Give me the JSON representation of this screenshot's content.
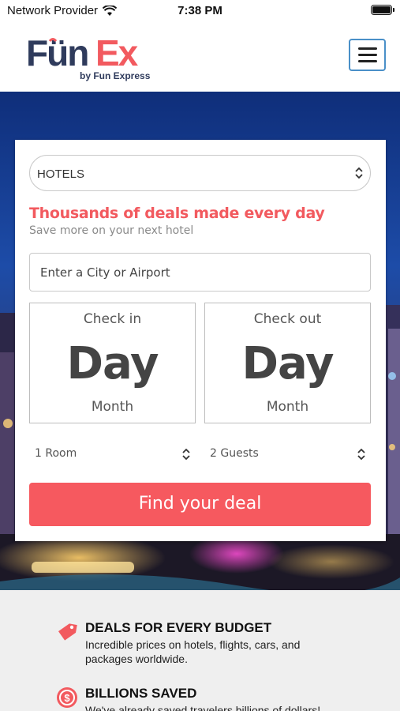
{
  "status_bar": {
    "carrier": "Network Provider",
    "time": "7:38 PM"
  },
  "header": {
    "logo_main": "FunEx",
    "logo_sub": "by Fun Express"
  },
  "search": {
    "type_selected": "HOTELS",
    "headline": "Thousands of deals made every day",
    "subline": "Save more on your next hotel",
    "city_placeholder": "Enter a City or Airport",
    "checkin": {
      "label": "Check in",
      "day": "Day",
      "month": "Month"
    },
    "checkout": {
      "label": "Check out",
      "day": "Day",
      "month": "Month"
    },
    "rooms_selected": "1 Room",
    "guests_selected": "2 Guests",
    "submit_label": "Find your deal"
  },
  "features": [
    {
      "icon": "price-tag-icon",
      "title": "DEALS FOR EVERY BUDGET",
      "desc": "Incredible prices on hotels, flights, cars, and packages worldwide."
    },
    {
      "icon": "dollar-coin-icon",
      "title": "BILLIONS SAVED",
      "desc": "We've already saved travelers billions of dollars!"
    }
  ],
  "colors": {
    "accent": "#f6595f",
    "logo_navy": "#2f3b5c",
    "menu_border": "#4a90c8"
  }
}
